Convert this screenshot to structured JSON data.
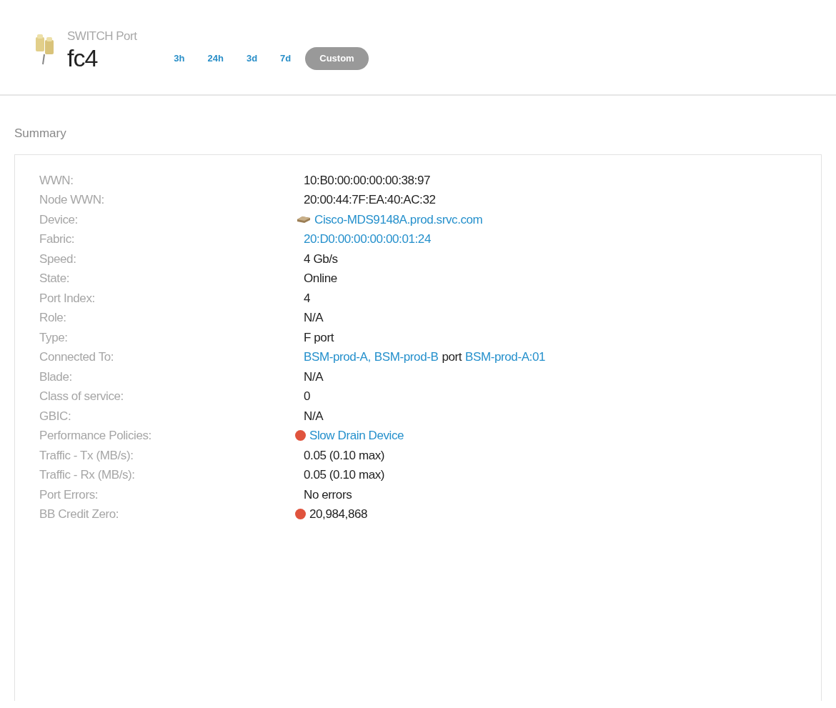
{
  "header": {
    "subtitle": "SWITCH Port",
    "title": "fc4"
  },
  "time_ranges": [
    {
      "label": "3h",
      "selected": false
    },
    {
      "label": "24h",
      "selected": false
    },
    {
      "label": "3d",
      "selected": false
    },
    {
      "label": "7d",
      "selected": false
    },
    {
      "label": "Custom",
      "selected": true
    }
  ],
  "summary": {
    "heading": "Summary",
    "rows": [
      {
        "label": "WWN:",
        "value": [
          {
            "kind": "text",
            "text": "10:B0:00:00:00:00:38:97"
          }
        ]
      },
      {
        "label": "Node WWN:",
        "value": [
          {
            "kind": "text",
            "text": "20:00:44:7F:EA:40:AC:32"
          }
        ]
      },
      {
        "label": "Device:",
        "kind": "device",
        "value": [
          {
            "kind": "link",
            "text": "Cisco-MDS9148A.prod.srvc.com"
          }
        ]
      },
      {
        "label": "Fabric:",
        "value": [
          {
            "kind": "link",
            "text": "20:D0:00:00:00:00:01:24"
          }
        ]
      },
      {
        "label": "Speed:",
        "value": [
          {
            "kind": "text",
            "text": "4 Gb/s"
          }
        ]
      },
      {
        "label": "State:",
        "value": [
          {
            "kind": "text",
            "text": "Online"
          }
        ]
      },
      {
        "label": "Port Index:",
        "value": [
          {
            "kind": "text",
            "text": "4"
          }
        ]
      },
      {
        "label": "Role:",
        "value": [
          {
            "kind": "text",
            "text": "N/A"
          }
        ]
      },
      {
        "label": "Type:",
        "value": [
          {
            "kind": "text",
            "text": "F port"
          }
        ]
      },
      {
        "label": "Connected To:",
        "value": [
          {
            "kind": "link",
            "text": "BSM-prod-A,"
          },
          {
            "kind": "link",
            "text": "BSM-prod-B"
          },
          {
            "kind": "text",
            "text": "port"
          },
          {
            "kind": "link",
            "text": "BSM-prod-A:01"
          }
        ]
      },
      {
        "label": "Blade:",
        "value": [
          {
            "kind": "text",
            "text": "N/A"
          }
        ]
      },
      {
        "label": "Class of service:",
        "value": [
          {
            "kind": "text",
            "text": "0"
          }
        ]
      },
      {
        "label": "GBIC:",
        "value": [
          {
            "kind": "text",
            "text": "N/A"
          }
        ]
      },
      {
        "label": "Performance Policies:",
        "color": "#e0533d",
        "value": [
          {
            "kind": "link",
            "text": "Slow Drain Device"
          }
        ]
      },
      {
        "label": "Traffic - Tx (MB/s):",
        "value": [
          {
            "kind": "text",
            "text": "0.05 (0.10 max)"
          }
        ]
      },
      {
        "label": "Traffic - Rx (MB/s):",
        "value": [
          {
            "kind": "text",
            "text": "0.05 (0.10 max)"
          }
        ]
      },
      {
        "label": "Port Errors:",
        "value": [
          {
            "kind": "text",
            "text": "No errors"
          }
        ]
      },
      {
        "label": "BB Credit Zero:",
        "color": "#e0533d",
        "value": [
          {
            "kind": "text",
            "text": "20,984,868"
          }
        ]
      }
    ]
  }
}
